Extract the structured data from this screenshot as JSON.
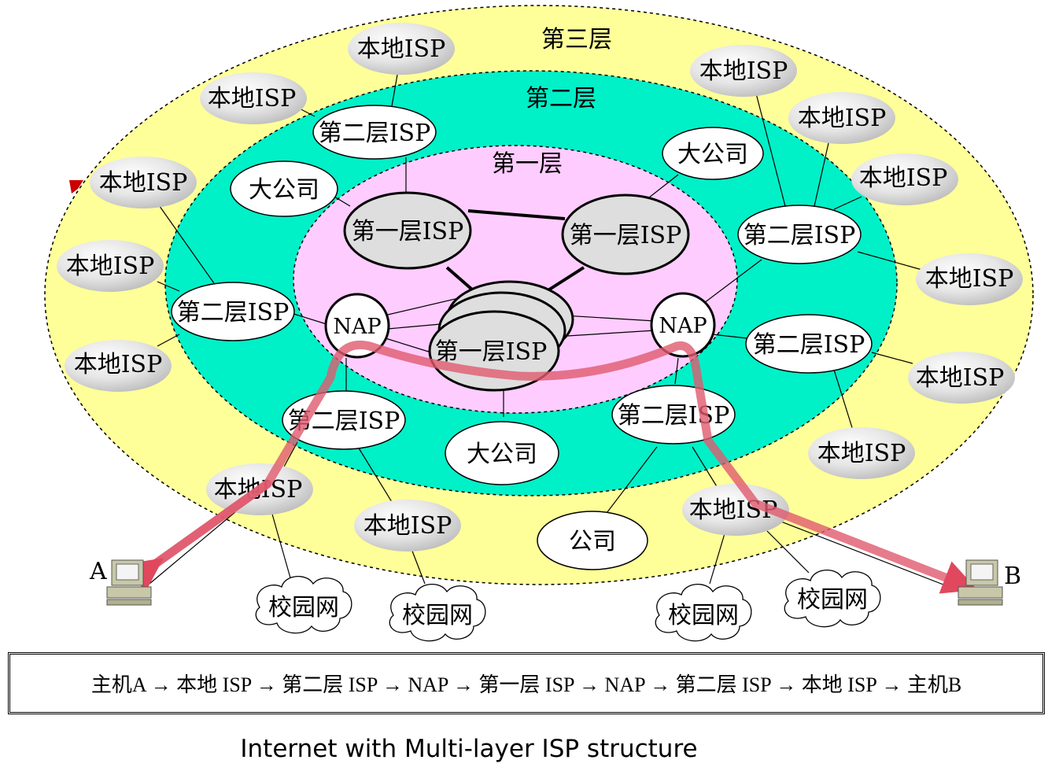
{
  "layers": {
    "layer3": "第三层",
    "layer2": "第二层",
    "layer1": "第一层"
  },
  "nodes": {
    "local_isp": "本地ISP",
    "tier2_isp": "第二层ISP",
    "tier1_isp": "第一层ISP",
    "nap": "NAP",
    "big_company": "大公司",
    "company": "公司",
    "campus_net": "校园网"
  },
  "hosts": {
    "a": "A",
    "b": "B"
  },
  "route": "主机A → 本地 ISP → 第二层 ISP → NAP → 第一层 ISP → NAP → 第二层 ISP → 本地 ISP → 主机B",
  "caption": "Internet with Multi-layer ISP structure",
  "colors": {
    "layer3_fill": "#ffff99",
    "layer2_fill": "#00f0c8",
    "layer1_fill": "#ffccff",
    "isp_bubble": "#dcdcdc",
    "path_stroke": "#e05a6e"
  }
}
